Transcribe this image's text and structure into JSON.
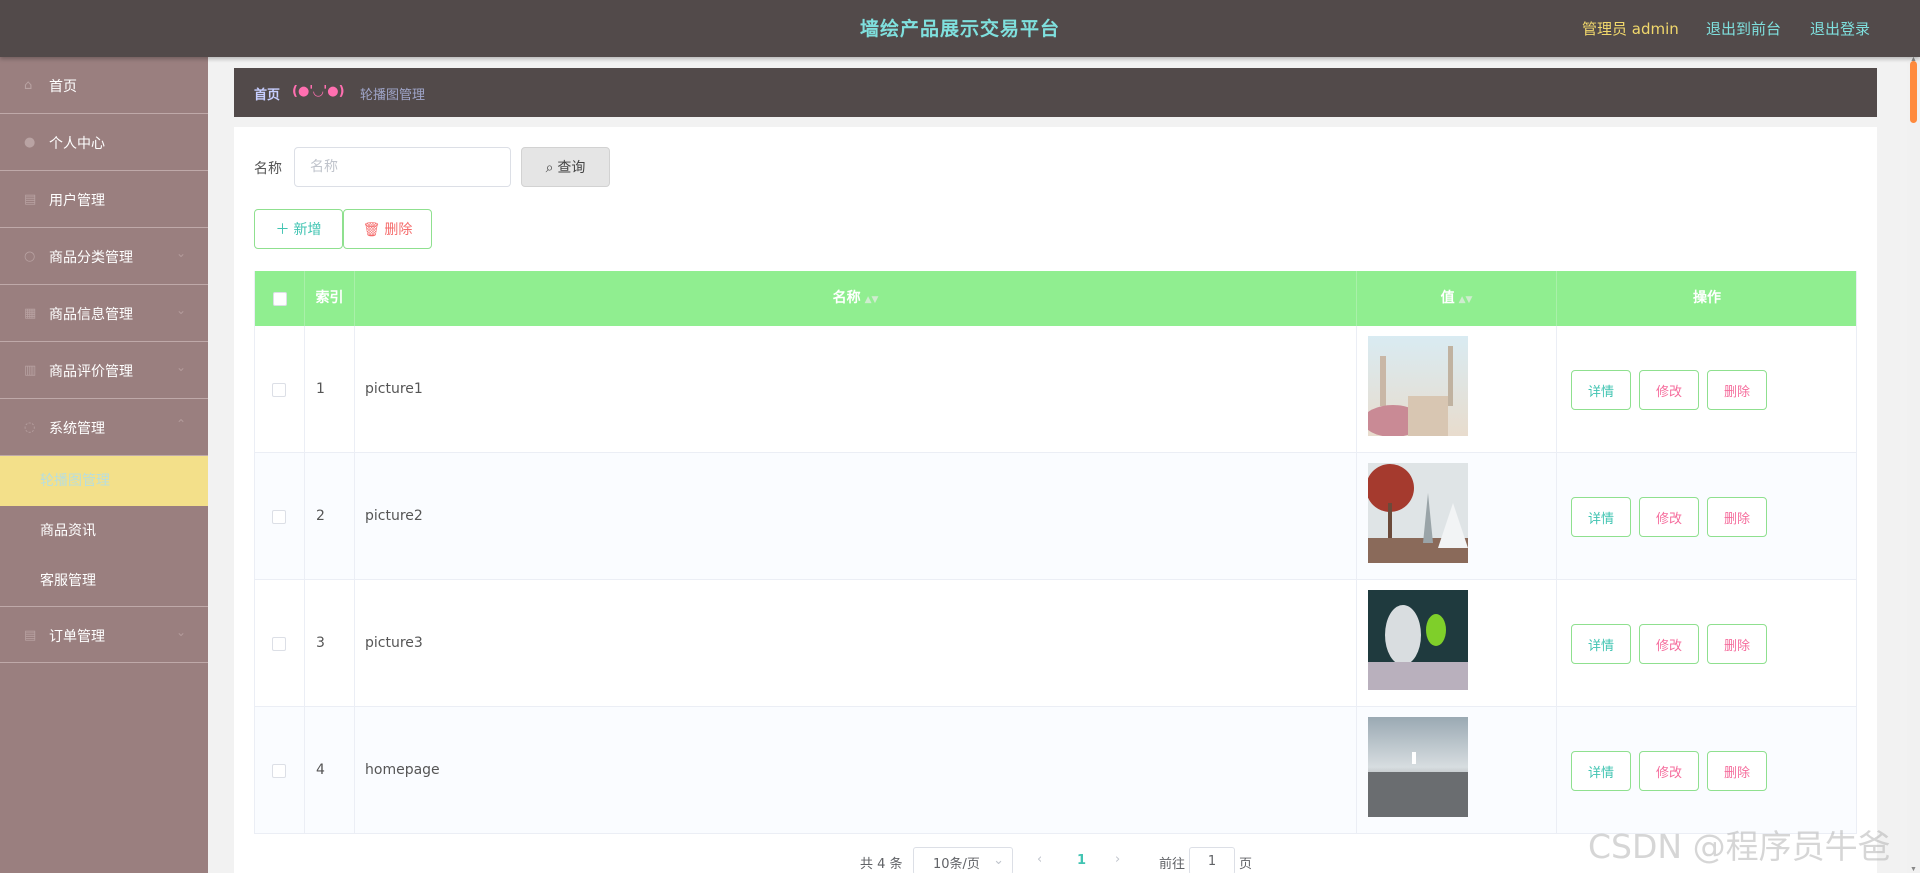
{
  "header": {
    "title": "墙绘产品展示交易平台",
    "admin_label": "管理员 admin",
    "to_front": "退出到前台",
    "logout": "退出登录"
  },
  "sidebar": {
    "items": [
      {
        "label": "首页",
        "icon": "home-icon"
      },
      {
        "label": "个人中心",
        "icon": "user-icon"
      },
      {
        "label": "用户管理",
        "icon": "users-icon"
      },
      {
        "label": "商品分类管理",
        "icon": "category-icon"
      },
      {
        "label": "商品信息管理",
        "icon": "grid-icon"
      },
      {
        "label": "商品评价管理",
        "icon": "comment-icon"
      },
      {
        "label": "系统管理",
        "icon": "settings-icon"
      },
      {
        "label": "订单管理",
        "icon": "order-icon"
      }
    ],
    "sub_items": [
      {
        "label": "轮播图管理",
        "active": true
      },
      {
        "label": "商品资讯",
        "active": false
      },
      {
        "label": "客服管理",
        "active": false
      }
    ]
  },
  "breadcrumb": {
    "home": "首页",
    "separator": "(●'◡'●)",
    "current": "轮播图管理"
  },
  "search": {
    "label": "名称",
    "placeholder": "名称",
    "button": "查询"
  },
  "actions": {
    "add": "新增",
    "delete": "删除"
  },
  "table": {
    "headers": [
      "索引",
      "名称",
      "值",
      "操作"
    ],
    "rows": [
      {
        "index": "1",
        "name": "picture1"
      },
      {
        "index": "2",
        "name": "picture2"
      },
      {
        "index": "3",
        "name": "picture3"
      },
      {
        "index": "4",
        "name": "homepage"
      }
    ],
    "op_labels": {
      "detail": "详情",
      "edit": "修改",
      "delete": "删除"
    }
  },
  "pagination": {
    "total": "共 4 条",
    "page_size": "10条/页",
    "current_page": "1",
    "goto_label": "前往",
    "goto_value": "1",
    "page_suffix": "页"
  },
  "watermark": "CSDN @程序员牛爸",
  "colors": {
    "header_bg": "#524a4a",
    "sidebar_bg": "#9a7f7f",
    "active_menu_bg": "#f3e08a",
    "table_header_bg": "#90ee90",
    "accent_teal": "#41c4b2"
  }
}
